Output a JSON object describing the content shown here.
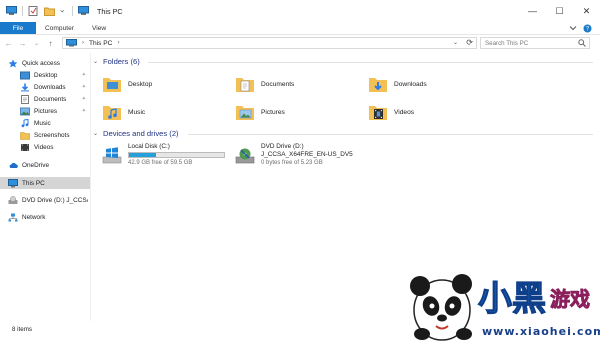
{
  "window": {
    "title": "This PC",
    "controls": {
      "minimize": "—",
      "maximize": "☐",
      "close": "✕"
    }
  },
  "ribbon": {
    "tabs": [
      "File",
      "Computer",
      "View"
    ]
  },
  "address": {
    "location": "This PC",
    "search_placeholder": "Search This PC"
  },
  "nav": {
    "quick_access": "Quick access",
    "quick_items": [
      "Desktop",
      "Downloads",
      "Documents",
      "Pictures",
      "Music",
      "Screenshots",
      "Videos"
    ],
    "onedrive": "OneDrive",
    "this_pc": "This PC",
    "dvd": "DVD Drive (D:) J_CCSA",
    "network": "Network"
  },
  "folders": {
    "heading": "Folders (6)",
    "items": [
      "Desktop",
      "Documents",
      "Downloads",
      "Music",
      "Pictures",
      "Videos"
    ]
  },
  "drives": {
    "heading": "Devices and drives (2)",
    "items": [
      {
        "name": "Local Disk (C:)",
        "free": "42.9 GB free of 59.5 GB",
        "used_fraction": 0.28
      },
      {
        "name": "DVD Drive (D:)",
        "label": "J_CCSA_X64FRE_EN-US_DV5",
        "free": "0 bytes free of 5.23 GB"
      }
    ]
  },
  "status": {
    "items": "8 items"
  },
  "watermark": {
    "brand": "小黑游戏",
    "url": "www.xiaohei.com"
  },
  "colors": {
    "accent": "#1979ca",
    "folder": "#f2c055",
    "group_heading": "#1e3287",
    "progress": "#26a0da"
  }
}
